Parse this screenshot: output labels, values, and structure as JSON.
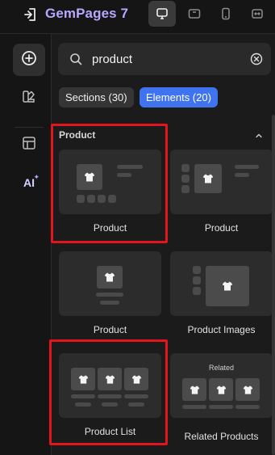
{
  "app": {
    "title": "GemPages 7"
  },
  "devices": [
    {
      "name": "desktop",
      "active": true
    },
    {
      "name": "tablet",
      "active": false
    },
    {
      "name": "mobile",
      "active": false
    },
    {
      "name": "fit-width",
      "active": false
    }
  ],
  "rail": {
    "items": [
      {
        "name": "add",
        "active": true
      },
      {
        "name": "design",
        "active": false
      },
      {
        "name": "layout",
        "active": false
      },
      {
        "name": "ai",
        "label": "AI",
        "active": false
      }
    ]
  },
  "search": {
    "value": "product",
    "placeholder": ""
  },
  "filters": {
    "sections_label": "Sections (30)",
    "elements_label": "Elements (20)",
    "active": "elements"
  },
  "group": {
    "title": "Product"
  },
  "cards": [
    {
      "label": "Product"
    },
    {
      "label": "Product"
    },
    {
      "label": "Product"
    },
    {
      "label": "Product Images"
    },
    {
      "label": "Product List"
    },
    {
      "label": "Related Products",
      "thumb_text": "Related"
    }
  ],
  "colors": {
    "accent": "#3f73f0",
    "brand": "#b9a6ff",
    "highlight": "#e3141b"
  }
}
